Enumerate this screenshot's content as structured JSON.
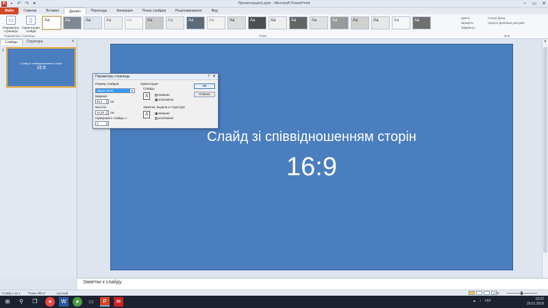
{
  "window": {
    "title": "Презентация1.pptx - Microsoft PowerPoint",
    "min": "‒",
    "max": "▭",
    "close": "✕"
  },
  "ribbon": {
    "tabs": [
      "Файл",
      "Главная",
      "Вставка",
      "Дизайн",
      "Переходы",
      "Анимация",
      "Показ слайдов",
      "Рецензирование",
      "Вид"
    ],
    "page_setup_btn": "Параметры страницы",
    "orientation_btn": "Ориентация слайда",
    "group_page_setup": "Параметры страницы",
    "group_themes": "Темы",
    "group_background": "Фон",
    "theme_label": "Aa",
    "colors": "Цвета",
    "fonts": "Шрифты",
    "effects": "Эффекты",
    "bg_styles": "Стили фона",
    "hide_bg": "Скрыть фоновые рисунки"
  },
  "leftpane": {
    "tab_slides": "Слайды",
    "tab_outline": "Структура",
    "slide_number": "1",
    "thumb_title": "Слайд зі співвідношенням сторін",
    "thumb_sub": "16:9"
  },
  "slide": {
    "title": "Слайд зі співвідношенням сторін",
    "subtitle": "16:9"
  },
  "notes": {
    "placeholder": "Заметки к слайду"
  },
  "dialog": {
    "title": "Параметры страницы",
    "help": "?",
    "close": "✕",
    "size_label": "Размер слайдов:",
    "size_value": "Экран (16:9)",
    "width_label": "Ширина:",
    "width_value": "25,4",
    "height_label": "Высота:",
    "height_value": "14,29",
    "unit": "см",
    "numbering_label": "Нумеровать слайды с:",
    "numbering_value": "1",
    "orientation_header": "Ориентация",
    "slides_label": "Слайды",
    "notes_label": "Заметки, выдачи и структура",
    "portrait": "книжная",
    "landscape": "альбомная",
    "ok": "ОК",
    "cancel": "Отмена"
  },
  "statusbar": {
    "slide_info": "Слайд 1 из 1",
    "theme": "\"Тема Office\"",
    "language": "русский",
    "zoom": "47%"
  },
  "taskbar": {
    "language": "УКР",
    "time": "16:02",
    "date": "29.01.2018"
  },
  "icons": {
    "start": "windows-start-icon",
    "search": "search-icon"
  }
}
